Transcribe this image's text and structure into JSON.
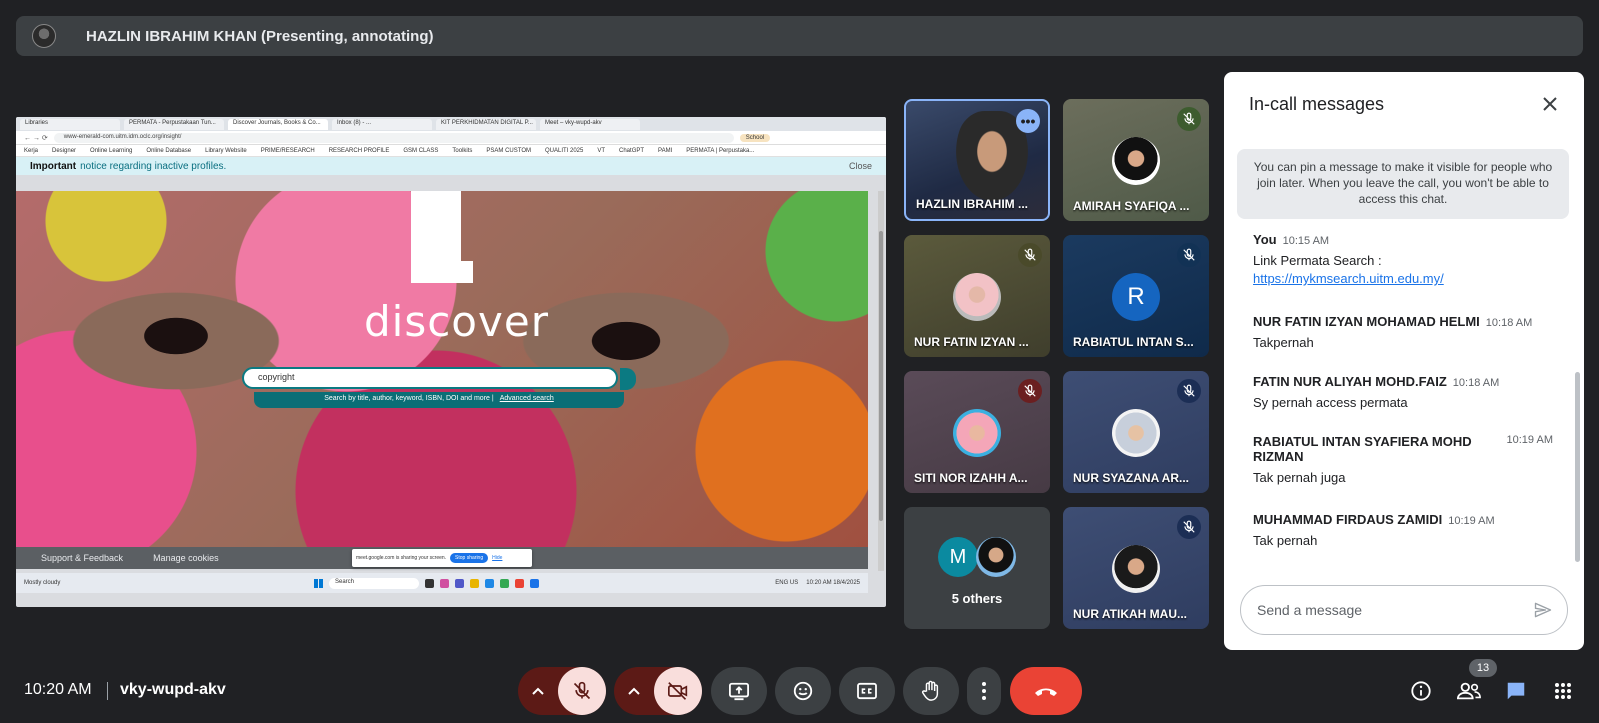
{
  "presenter_bar": {
    "title": "HAZLIN IBRAHIM KHAN (Presenting, annotating)"
  },
  "shared_screen": {
    "tabs": [
      "Libraries",
      "PERMATA - Perpustakaan Tun...",
      "Discover Journals, Books & Co...",
      "Inbox (8) - ...",
      "KIT PERKHIDMATAN DIGITAL P...",
      "Meet – vky-wupd-akv"
    ],
    "url": "www-emerald-com.uitm.idm.oclc.org/insight/",
    "profile_pill": "School",
    "bookmarks": [
      "Kerja",
      "Designer",
      "Online Learning",
      "Online Database",
      "Library Website",
      "PRIME/RESEARCH",
      "RESEARCH PROFILE",
      "GSM CLASS",
      "Toolkits",
      "PSAM CUSTOM",
      "QUALITI 2025",
      "VT",
      "ChatGPT",
      "PAMI",
      "PERMATA | Perpustaka..."
    ],
    "notice_bold": "Important",
    "notice_text": "notice regarding inactive profiles.",
    "notice_close": "Close",
    "logo_text": "discover",
    "search_value": "copyright",
    "search_hint": "Search by title, author, keyword, ISBN, DOI and more   |",
    "advanced_search": "Advanced search",
    "footer_links": [
      "Support & Feedback",
      "Manage cookies"
    ],
    "sharing_text": "meet.google.com is sharing your screen.",
    "stop_sharing": "Stop sharing",
    "hide": "Hide",
    "taskbar_weather": "Mostly cloudy",
    "taskbar_search": "Search",
    "taskbar_lang": "ENG US",
    "taskbar_clock": "10:20 AM 18/4/2025"
  },
  "participants": [
    {
      "name": "HAZLIN IBRAHIM ...",
      "muted": false,
      "active_speaker": true
    },
    {
      "name": "AMIRAH SYAFIQA ...",
      "muted": true
    },
    {
      "name": "NUR FATIN IZYAN ...",
      "muted": true
    },
    {
      "name": "RABIATUL INTAN S...",
      "muted": true,
      "letter": "R"
    },
    {
      "name": "SITI NOR IZAHH A...",
      "muted": true
    },
    {
      "name": "NUR SYAZANA AR...",
      "muted": true
    },
    {
      "name": "5 others",
      "letter": "M"
    },
    {
      "name": "NUR ATIKAH MAU...",
      "muted": true
    }
  ],
  "chat": {
    "title": "In-call messages",
    "pin_note": "You can pin a message to make it visible for people who join later. When you leave the call, you won't be able to access this chat.",
    "messages": [
      {
        "sender": "You",
        "time": "10:15 AM",
        "text": "Link Permata Search :",
        "link": "https://mykmsearch.uitm.edu.my/"
      },
      {
        "sender": "NUR FATIN IZYAN MOHAMAD HELMI",
        "time": "10:18 AM",
        "text": "Takpernah"
      },
      {
        "sender": "FATIN NUR ALIYAH MOHD.FAIZ",
        "time": "10:18 AM",
        "text": "Sy pernah access permata"
      },
      {
        "sender": "RABIATUL INTAN SYAFIERA MOHD RIZMAN",
        "time": "10:19 AM",
        "text": "Tak pernah juga"
      },
      {
        "sender": "MUHAMMAD FIRDAUS ZAMIDI",
        "time": "10:19 AM",
        "text": "Tak pernah"
      }
    ],
    "input_placeholder": "Send a message"
  },
  "bottom_bar": {
    "time": "10:20 AM",
    "meeting_code": "vky-wupd-akv",
    "people_count": "13"
  },
  "colors": {
    "background": "#202124",
    "end_call": "#ea4335",
    "mic_off_group": "#5c1a16",
    "accent_blue": "#8ab4f8"
  }
}
